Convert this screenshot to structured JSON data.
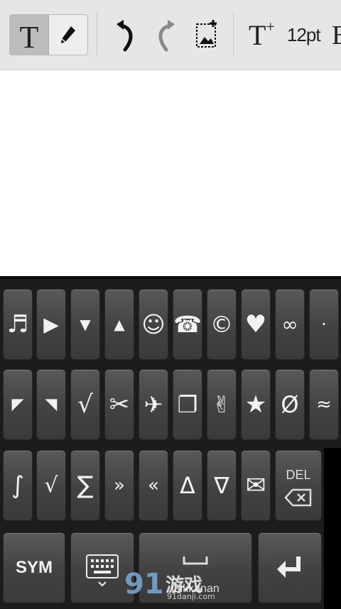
{
  "toolbar": {
    "text_tool_label": "T",
    "text_size_label": "12pt",
    "bold_label": "B",
    "font_size_up_label": "T",
    "font_size_up_sup": "+"
  },
  "keyboard": {
    "row1": [
      "♬",
      "▶",
      "▼",
      "▲",
      "☺",
      "☎",
      "©",
      "♥",
      "∞",
      "·"
    ],
    "row2": [
      "◤",
      "◥",
      "√",
      "✂",
      "✈",
      "❐",
      "✌",
      "★",
      "Ø",
      "≈"
    ],
    "row3": [
      "∫",
      "√",
      "∑",
      "»",
      "«",
      "Δ",
      "∇",
      "✉"
    ],
    "del_label": "DEL",
    "sym_label": "SYM",
    "space_label": "Gikkanan"
  },
  "watermark": {
    "number": "91",
    "text": "游戏",
    "url": "91danji.com"
  },
  "colors": {
    "toolbar_bg": "#e6e6e6",
    "keyboard_bg": "#1c1c1c",
    "key_bg": "#4a4a4a"
  }
}
